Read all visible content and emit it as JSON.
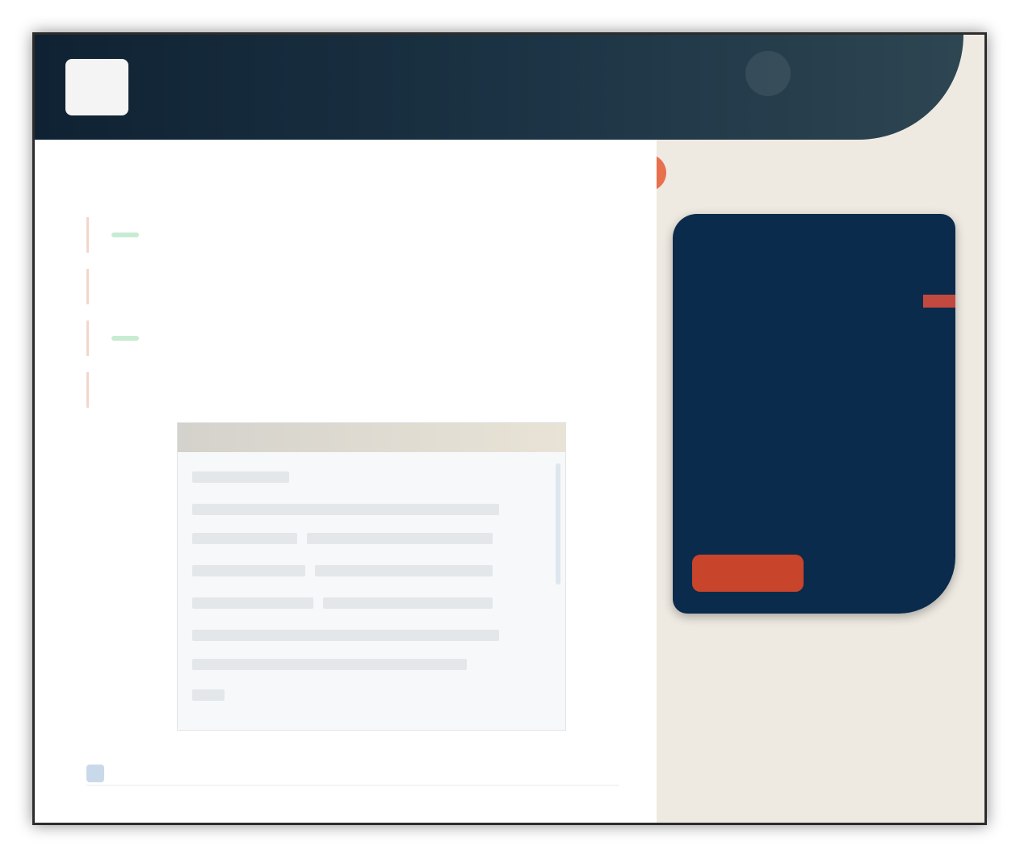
{
  "header": {
    "title": "",
    "subtitle": "",
    "user": ""
  },
  "toolbar": {
    "buttons": [
      {
        "icon": "home-icon",
        "glyph": "⌂"
      },
      {
        "icon": "folder-icon",
        "glyph": "▤"
      },
      {
        "icon": "settings-icon",
        "glyph": "⚙"
      },
      {
        "icon": "alert-icon",
        "glyph": "!"
      }
    ],
    "alert_color": "#e8704e"
  },
  "list": {
    "rows": [
      {
        "label": "",
        "meta": "",
        "value": ""
      },
      {
        "label": "",
        "meta": "",
        "value": ""
      },
      {
        "label": "",
        "meta": "",
        "value": ""
      },
      {
        "label": "",
        "meta": "",
        "value": ""
      }
    ]
  },
  "document_panel": {
    "header": ""
  },
  "footer": {
    "note": ""
  },
  "side_card": {
    "title": "",
    "big_line_1": "",
    "big_line_2": "",
    "detail_1": "",
    "detail_2": "",
    "button_label": "",
    "background": "#0a2b4c",
    "button_color": "#c8442b"
  }
}
